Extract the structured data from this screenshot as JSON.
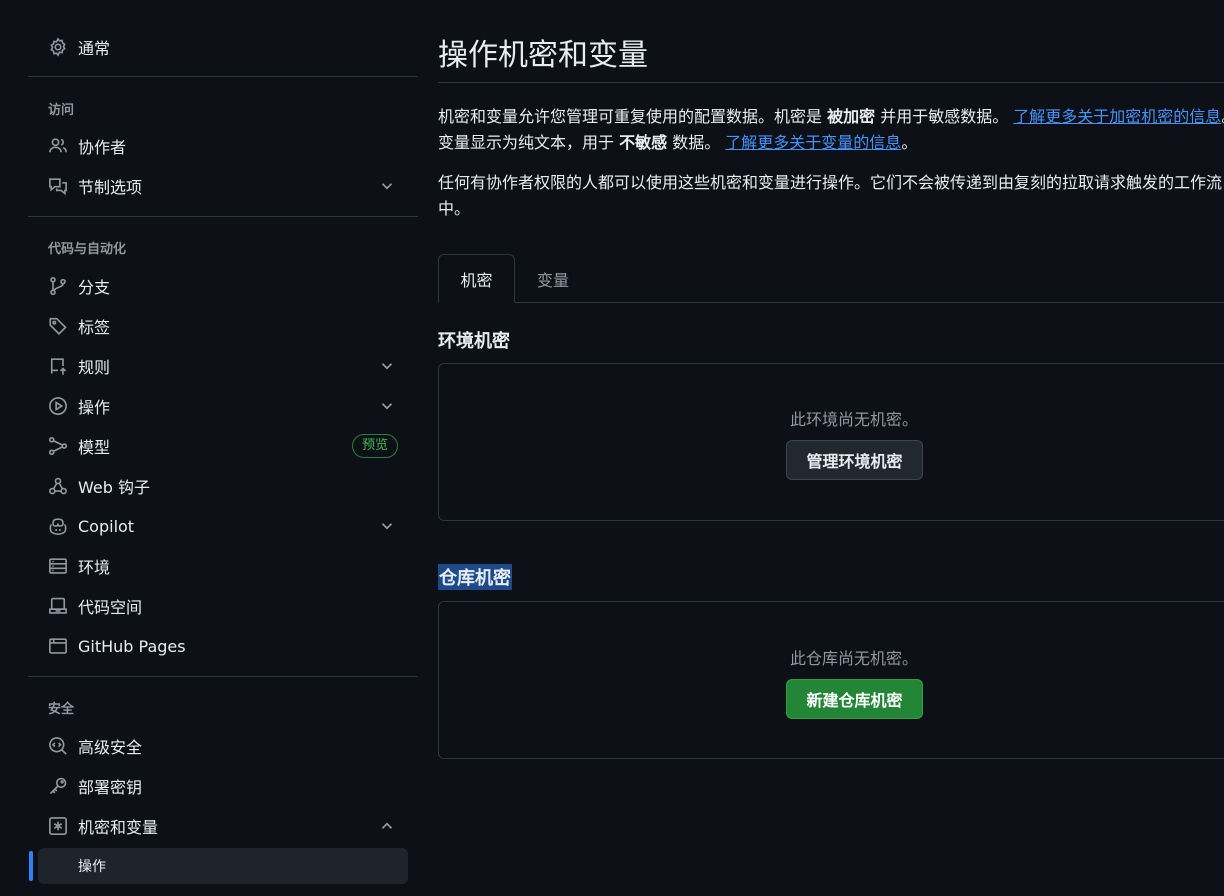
{
  "sidebar": {
    "general": "通常",
    "sections": {
      "access": "访问",
      "code_automation": "代码与自动化",
      "security": "安全"
    },
    "items": {
      "collaborators": "协作者",
      "moderation": "节制选项",
      "branches": "分支",
      "tags": "标签",
      "rules": "规则",
      "actions": "操作",
      "models": "模型",
      "models_badge": "预览",
      "webhooks": "Web 钩子",
      "copilot": "Copilot",
      "environments": "环境",
      "codespaces": "代码空间",
      "pages": "GitHub Pages",
      "advanced_security": "高级安全",
      "deploy_keys": "部署密钥",
      "secrets_variables": "机密和变量",
      "secrets_actions": "操作"
    }
  },
  "main": {
    "title": "操作机密和变量",
    "desc1": {
      "a": "机密和变量允许您管理可重复使用的配置数据。机密是 ",
      "b": "被加密",
      "c": " 并用于敏感数据。 ",
      "link1": "了解更多关于加密机密的信息",
      "d": "。变量显示为纯文本，用于 ",
      "e": "不敏感",
      "f": " 数据。 ",
      "link2": "了解更多关于变量的信息",
      "g": "。"
    },
    "desc2": "任何有协作者权限的人都可以使用这些机密和变量进行操作。它们不会被传递到由复刻的拉取请求触发的工作流中。",
    "tabs": [
      "机密",
      "变量"
    ],
    "env_secrets": {
      "title": "环境机密",
      "empty": "此环境尚无机密。",
      "button": "管理环境机密"
    },
    "repo_secrets": {
      "title": "仓库机密",
      "empty": "此仓库尚无机密。",
      "button": "新建仓库机密"
    }
  },
  "colors": {
    "background": "#0d1117",
    "accent_link": "#4493f8",
    "primary_button": "#238636",
    "badge_green": "#3fb950",
    "active_marker": "#2f81f7"
  }
}
